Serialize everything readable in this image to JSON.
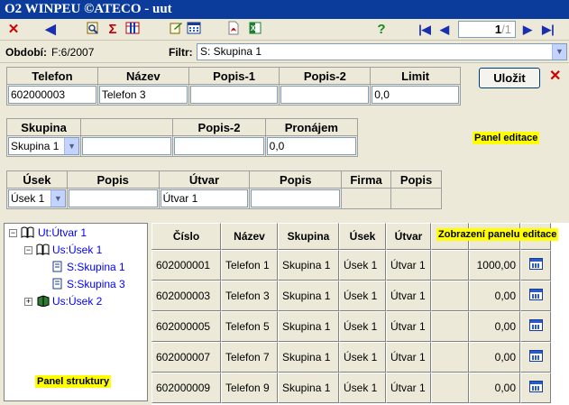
{
  "window": {
    "title": "O2 WINPEU ©ATECO - uut"
  },
  "toolbar": {
    "close_glyph": "✕",
    "back_glyph": "◀",
    "sum_glyph": "Σ",
    "help_glyph": "?",
    "first_glyph": "|◀",
    "prev_glyph": "◀",
    "next_glyph": "▶",
    "last_glyph": "▶|",
    "page_current": "1",
    "page_total": "/1"
  },
  "filter_row": {
    "period_label": "Období:",
    "period_value": "F:6/2007",
    "filter_label": "Filtr:",
    "filter_value": "S: Skupina 1"
  },
  "edit_panel": {
    "row1": {
      "headers": [
        "Telefon",
        "Název",
        "Popis-1",
        "Popis-2",
        "Limit"
      ],
      "values": [
        "602000003",
        "Telefon 3",
        "",
        "",
        "0,0"
      ]
    },
    "row2": {
      "headers": [
        "Skupina",
        "",
        "Popis-2",
        "Pronájem"
      ],
      "skupina_value": "Skupina 1",
      "pronajem_value": "0,0"
    },
    "row3": {
      "headers": [
        "Úsek",
        "Popis",
        "Útvar",
        "Popis",
        "Firma",
        "Popis"
      ],
      "usek_value": "Úsek 1",
      "utvar_value": "Útvar 1"
    },
    "save_label": "Uložit",
    "close_glyph": "✕",
    "note": "Panel editace"
  },
  "tree": {
    "items": [
      {
        "label": "Ut:Útvar 1",
        "expander": "−"
      },
      {
        "label": "Us:Úsek 1",
        "expander": "−"
      },
      {
        "label": "S:Skupina 1"
      },
      {
        "label": "S:Skupina 3"
      },
      {
        "label": "Us:Úsek 2",
        "expander": "+"
      }
    ],
    "note": "Panel struktury"
  },
  "grid": {
    "headers": [
      "Číslo",
      "Název",
      "Skupina",
      "Úsek",
      "Útvar",
      "",
      "",
      ""
    ],
    "note": "Zobrazení panelu editace",
    "rows": [
      [
        "602000001",
        "Telefon 1",
        "Skupina 1",
        "Úsek 1",
        "Útvar 1",
        "",
        "1000,00"
      ],
      [
        "602000003",
        "Telefon 3",
        "Skupina 1",
        "Úsek 1",
        "Útvar 1",
        "",
        "0,00"
      ],
      [
        "602000005",
        "Telefon 5",
        "Skupina 1",
        "Úsek 1",
        "Útvar 1",
        "",
        "0,00"
      ],
      [
        "602000007",
        "Telefon 7",
        "Skupina 1",
        "Úsek 1",
        "Útvar 1",
        "",
        "0,00"
      ],
      [
        "602000009",
        "Telefon 9",
        "Skupina 1",
        "Úsek 1",
        "Útvar 1",
        "",
        "0,00"
      ]
    ]
  },
  "colors": {
    "titlebar": "#0b3c9c",
    "note_highlight": "#ffff00",
    "tree_text": "#0000ff",
    "close_red": "#d00000"
  }
}
